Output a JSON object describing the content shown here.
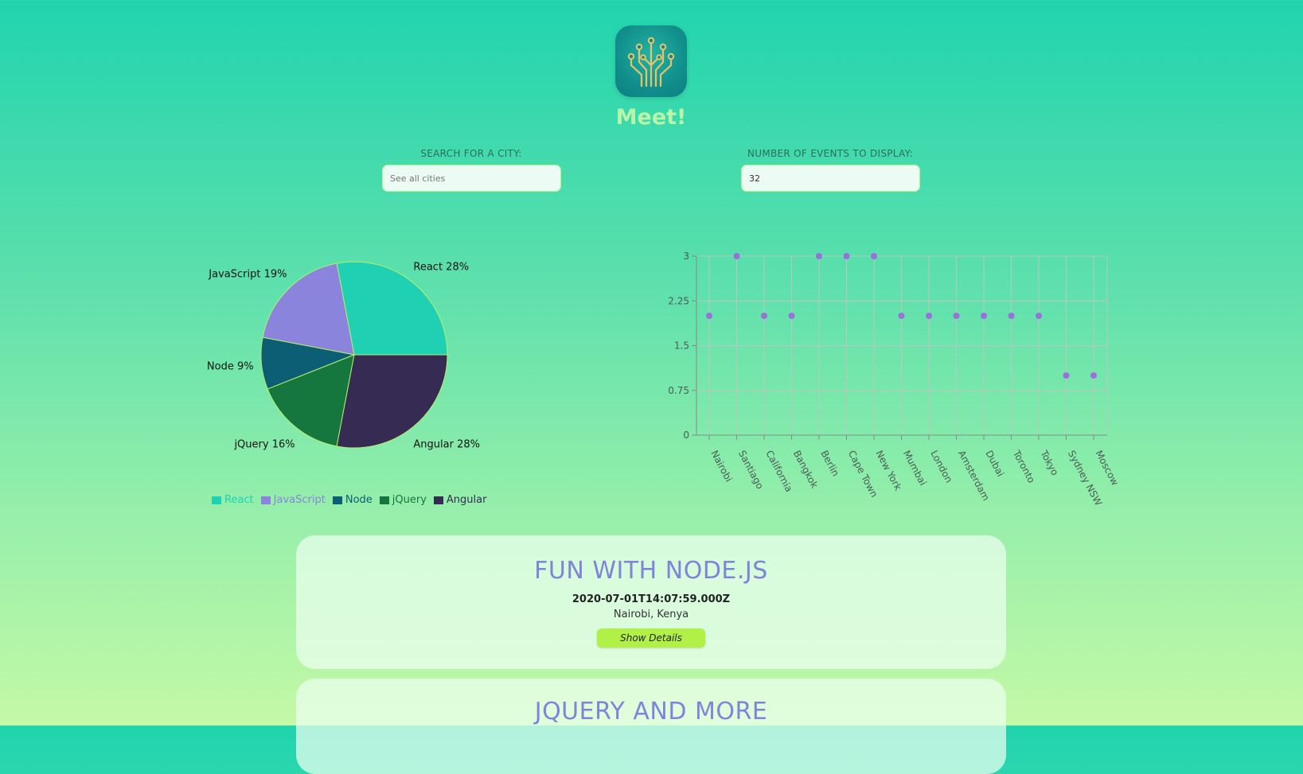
{
  "app": {
    "title": "Meet!",
    "logo_icon": "circuit-tree-icon"
  },
  "search": {
    "label": "SEARCH FOR A CITY:",
    "placeholder": "See all cities",
    "value": ""
  },
  "events_count": {
    "label": "NUMBER OF EVENTS TO DISPLAY:",
    "value": "32"
  },
  "colors": {
    "React": "#1fd1b2",
    "JavaScript": "#8a84dc",
    "Node": "#0b5e74",
    "jQuery": "#15763e",
    "Angular": "#362b52",
    "scatter_point": "#9b6fdc",
    "button": "#b1f046",
    "event_title": "#7f84d9"
  },
  "chart_data": [
    {
      "type": "pie",
      "categories": [
        "React",
        "JavaScript",
        "Node",
        "jQuery",
        "Angular"
      ],
      "values": [
        28,
        19,
        9,
        16,
        28
      ],
      "labels": [
        "React 28%",
        "JavaScript 19%",
        "Node 9%",
        "jQuery 16%",
        "Angular 28%"
      ],
      "legend": [
        "React",
        "JavaScript",
        "Node",
        "jQuery",
        "Angular"
      ],
      "legend_placement": "bottom"
    },
    {
      "type": "scatter",
      "categories": [
        "Nairobi",
        "Santiago",
        "California",
        "Bangkok",
        "Berlin",
        "Cape Town",
        "New York",
        "Mumbai",
        "London",
        "Amsterdam",
        "Dubai",
        "Toronto",
        "Tokyo",
        "Sydney NSW",
        "Moscow"
      ],
      "values": [
        2,
        3,
        2,
        2,
        3,
        3,
        3,
        2,
        2,
        2,
        2,
        2,
        2,
        1,
        1
      ],
      "yticks": [
        "0",
        "0.75",
        "1.5",
        "2.25",
        "3"
      ],
      "ylim": [
        0,
        3
      ],
      "grid": true
    }
  ],
  "events": [
    {
      "title": "FUN WITH NODE.JS",
      "time": "2020-07-01T14:07:59.000Z",
      "location": "Nairobi, Kenya",
      "button_label": "Show Details"
    },
    {
      "title": "JQUERY AND MORE"
    }
  ]
}
